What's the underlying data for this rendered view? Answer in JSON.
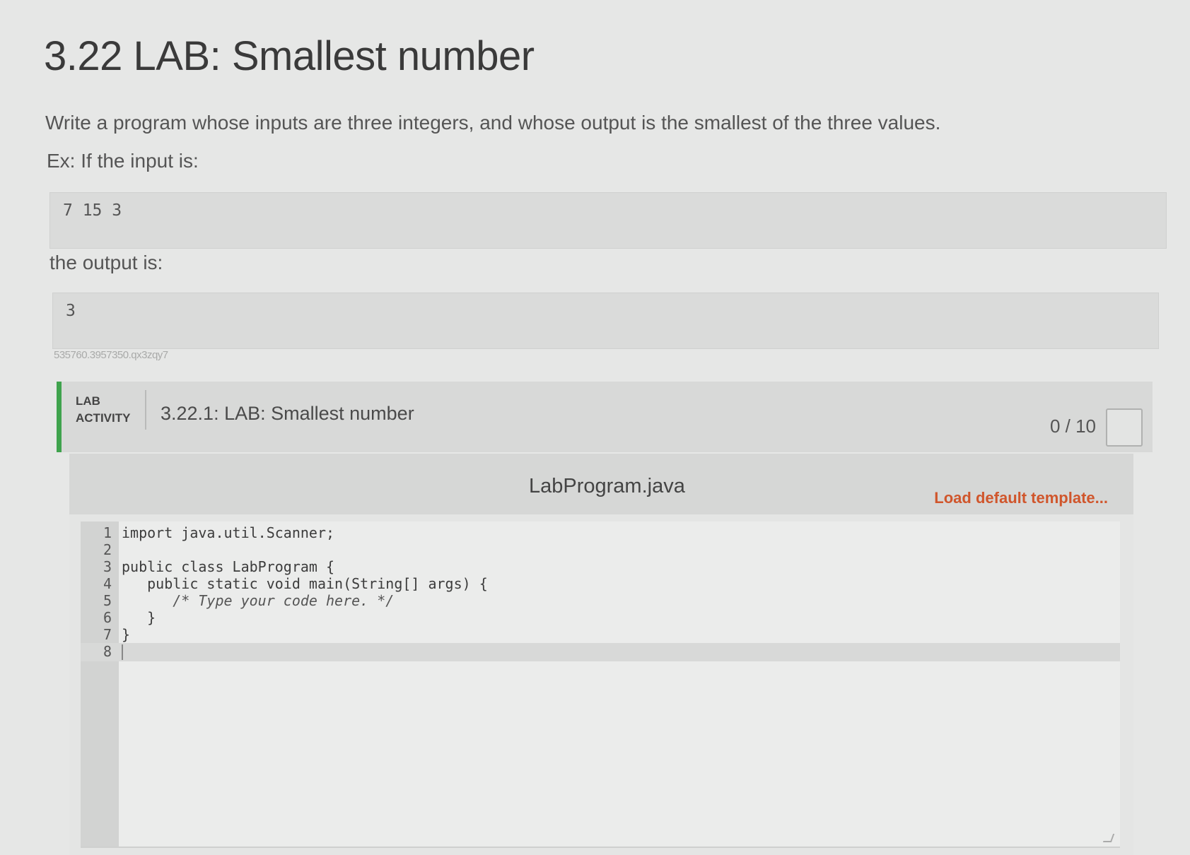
{
  "page": {
    "title": "3.22 LAB: Smallest number",
    "prompt": "Write a program whose inputs are three integers, and whose output is the smallest of the three values.",
    "example_label": "Ex: If the input is:",
    "example_input": "7 15 3",
    "output_label": "the output is:",
    "example_output": "3",
    "hash_text": "535760.3957350.qx3zqy7"
  },
  "lab": {
    "tag_line1": "LAB",
    "tag_line2": "ACTIVITY",
    "title": "3.22.1: LAB: Smallest number",
    "score": "0 / 10",
    "accent_color": "#3fa34d"
  },
  "editor": {
    "filename": "LabProgram.java",
    "load_template_label": "Load default template...",
    "load_template_color": "#d0562c",
    "lines": [
      {
        "num": "1",
        "code": "import java.util.Scanner;"
      },
      {
        "num": "2",
        "code": ""
      },
      {
        "num": "3",
        "code": "public class LabProgram {"
      },
      {
        "num": "4",
        "code": "   public static void main(String[] args) {"
      },
      {
        "num": "5",
        "code": "      /* Type your code here. */"
      },
      {
        "num": "6",
        "code": "   }"
      },
      {
        "num": "7",
        "code": "}"
      },
      {
        "num": "8",
        "code": ""
      }
    ]
  }
}
